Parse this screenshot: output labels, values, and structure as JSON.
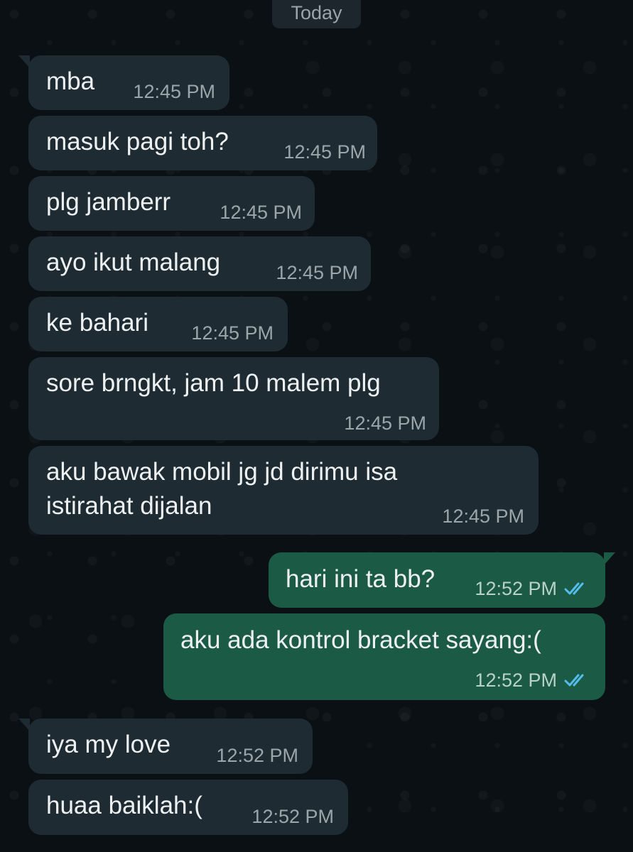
{
  "date_divider": "Today",
  "messages": [
    {
      "text": "mba",
      "time": "12:45 PM"
    },
    {
      "text": "masuk pagi toh?",
      "time": "12:45 PM"
    },
    {
      "text": "plg jamberr",
      "time": "12:45 PM"
    },
    {
      "text": "ayo ikut malang",
      "time": "12:45 PM"
    },
    {
      "text": "ke bahari",
      "time": "12:45 PM"
    },
    {
      "text": "sore brngkt, jam 10 malem plg",
      "time": "12:45 PM"
    },
    {
      "text": "aku bawak mobil jg jd dirimu isa istirahat dijalan",
      "time": "12:45 PM"
    },
    {
      "text": "hari ini ta bb?",
      "time": "12:52 PM",
      "status": "double-check-icon"
    },
    {
      "text": "aku ada kontrol bracket sayang:(",
      "time": "12:52 PM",
      "status": "double-check-icon"
    },
    {
      "text": "iya my love",
      "time": "12:52 PM"
    },
    {
      "text": "huaa baiklah:(",
      "time": "12:52 PM"
    }
  ],
  "colors": {
    "incoming_bubble": "#1f2b32",
    "outgoing_bubble": "#1b5a45",
    "read_ticks": "#53bdeb",
    "background": "#0b1014"
  }
}
